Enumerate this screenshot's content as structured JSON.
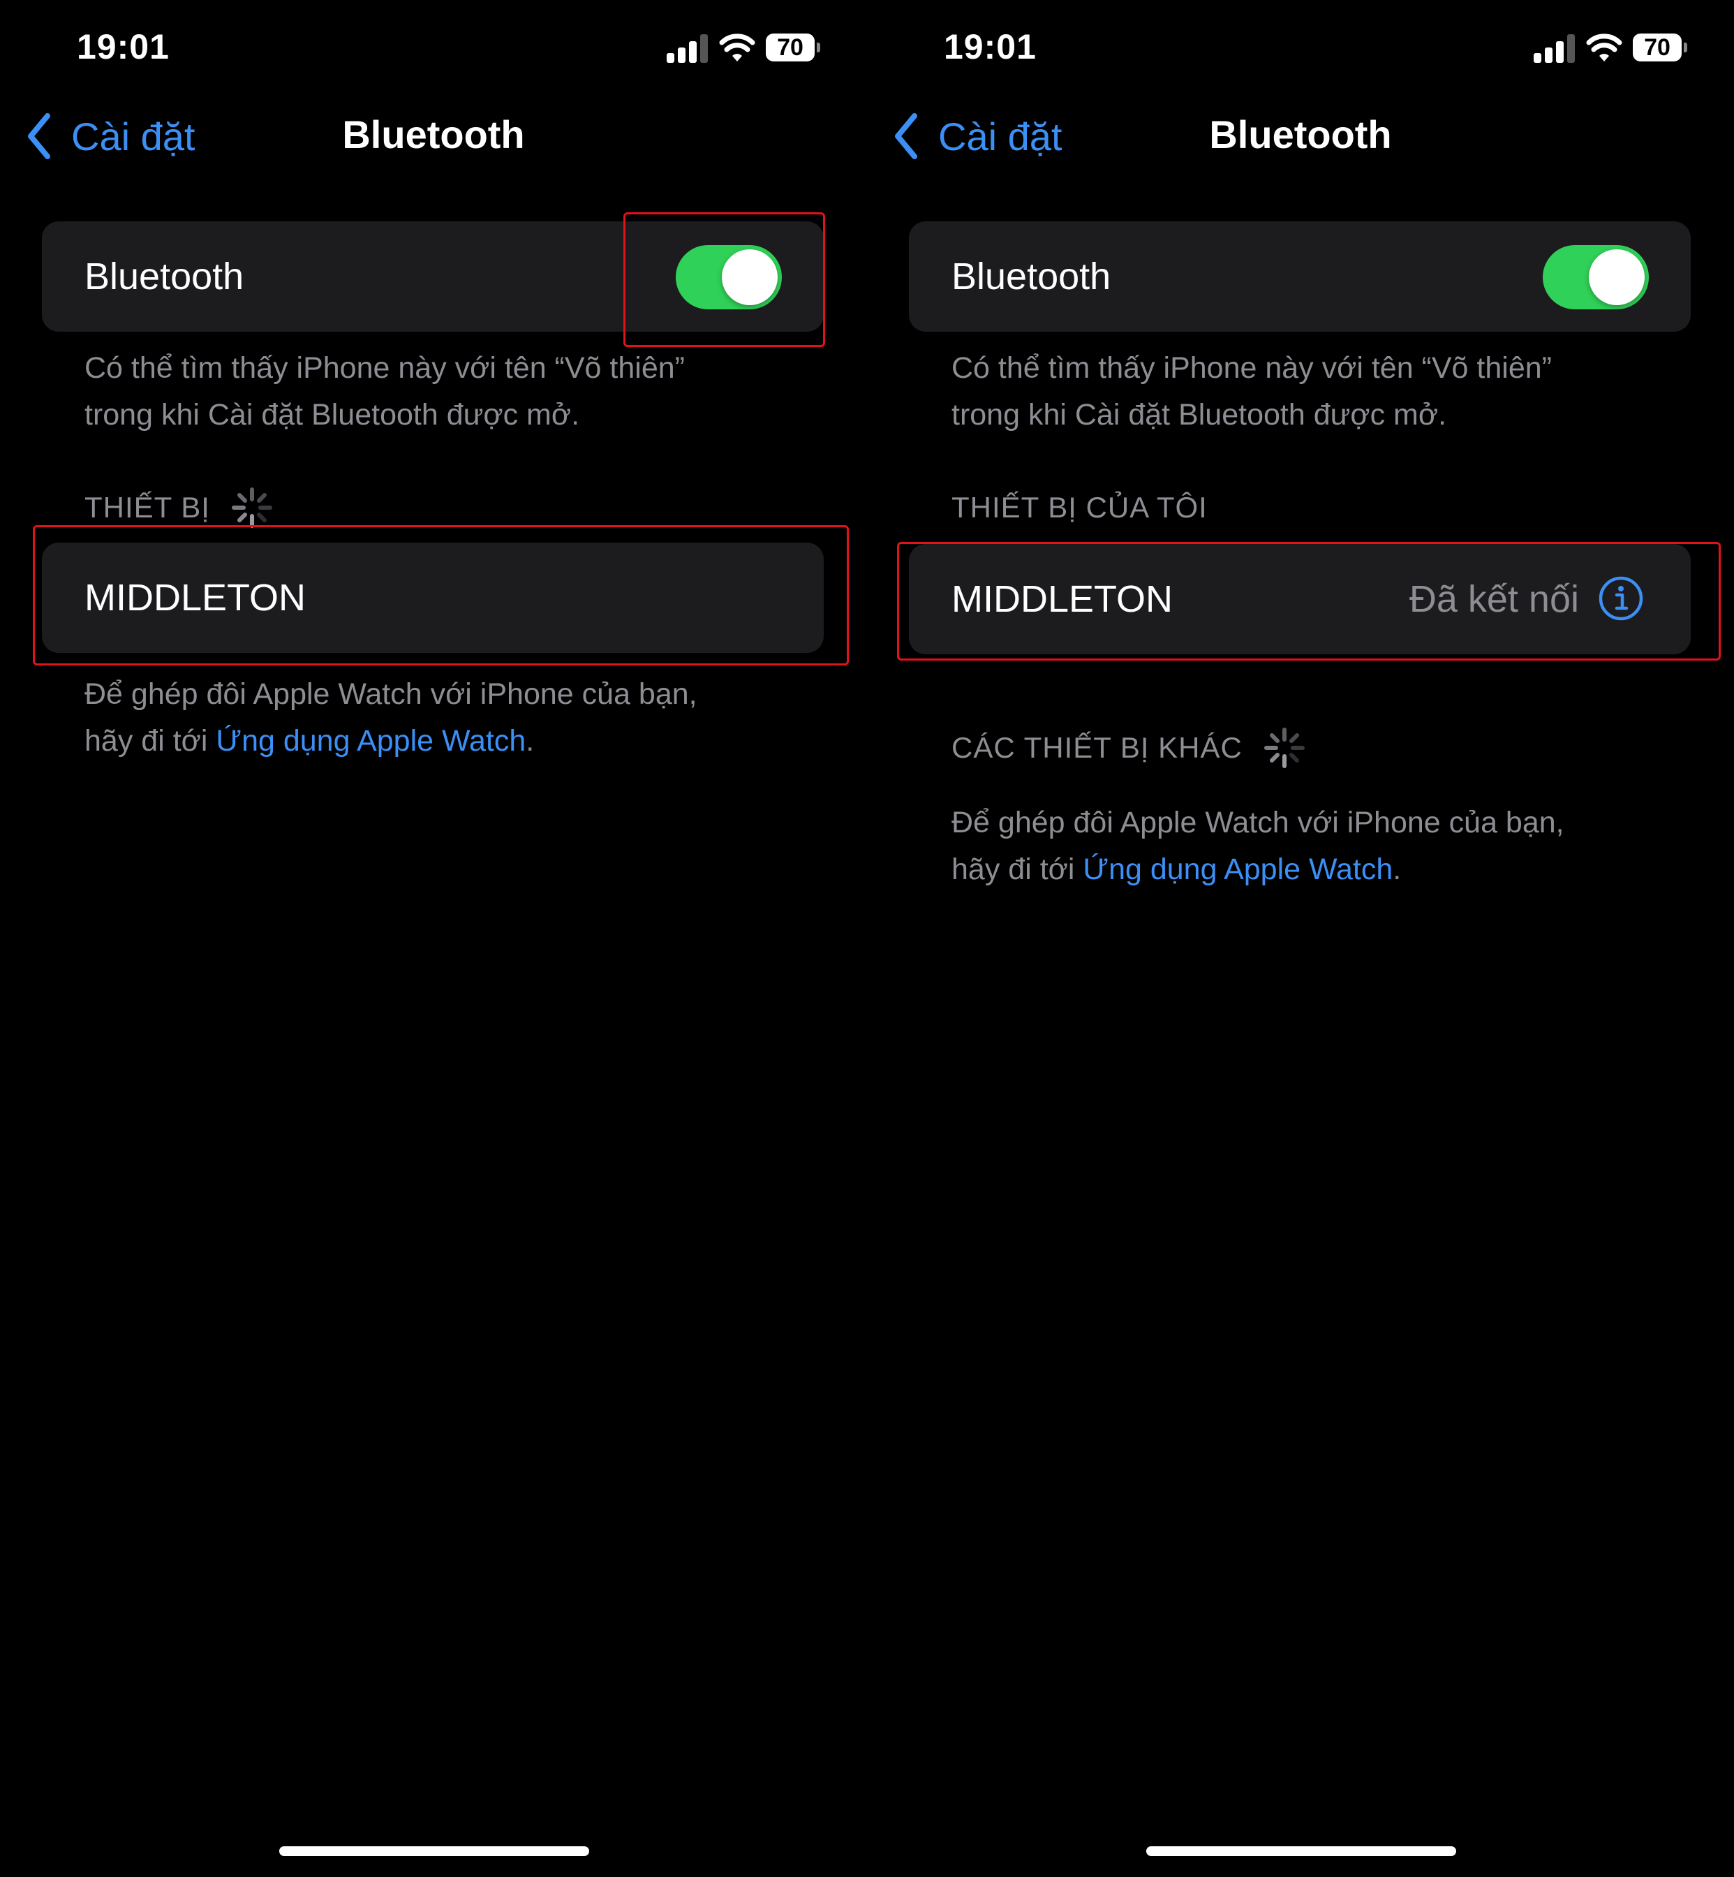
{
  "colors": {
    "background": "#000000",
    "cell": "#1c1c1e",
    "accent_blue": "#3b8ff5",
    "toggle_on": "#30d158",
    "secondary_text": "#8d8d93",
    "highlight": "#e0131b"
  },
  "left": {
    "status": {
      "time": "19:01",
      "battery": "70"
    },
    "nav": {
      "back_label": "Cài đặt",
      "title": "Bluetooth"
    },
    "bluetooth_cell": {
      "label": "Bluetooth",
      "enabled": true
    },
    "discoverable_note": {
      "line1": "Có thể tìm thấy iPhone này với tên “Võ thiên”",
      "line2": "trong khi Cài đặt Bluetooth được mở."
    },
    "devices_header": "THIẾT BỊ",
    "device": {
      "name": "MIDDLETON"
    },
    "watch_note": {
      "line1": "Để ghép đôi Apple Watch với iPhone của bạn,",
      "prefix": "hãy đi tới ",
      "link": "Ứng dụng Apple Watch",
      "suffix": "."
    }
  },
  "right": {
    "status": {
      "time": "19:01",
      "battery": "70"
    },
    "nav": {
      "back_label": "Cài đặt",
      "title": "Bluetooth"
    },
    "bluetooth_cell": {
      "label": "Bluetooth",
      "enabled": true
    },
    "discoverable_note": {
      "line1": "Có thể tìm thấy iPhone này với tên “Võ thiên”",
      "line2": "trong khi Cài đặt Bluetooth được mở."
    },
    "my_devices_header": "THIẾT BỊ CỦA TÔI",
    "device": {
      "name": "MIDDLETON",
      "status": "Đã kết nối"
    },
    "other_devices_header": "CÁC THIẾT BỊ KHÁC",
    "watch_note": {
      "line1": "Để ghép đôi Apple Watch với iPhone của bạn,",
      "prefix": "hãy đi tới ",
      "link": "Ứng dụng Apple Watch",
      "suffix": "."
    }
  },
  "icons": [
    "cellular-signal-icon",
    "wifi-icon",
    "battery-icon",
    "chevron-left-icon",
    "loading-spinner-icon",
    "info-circle-icon"
  ]
}
